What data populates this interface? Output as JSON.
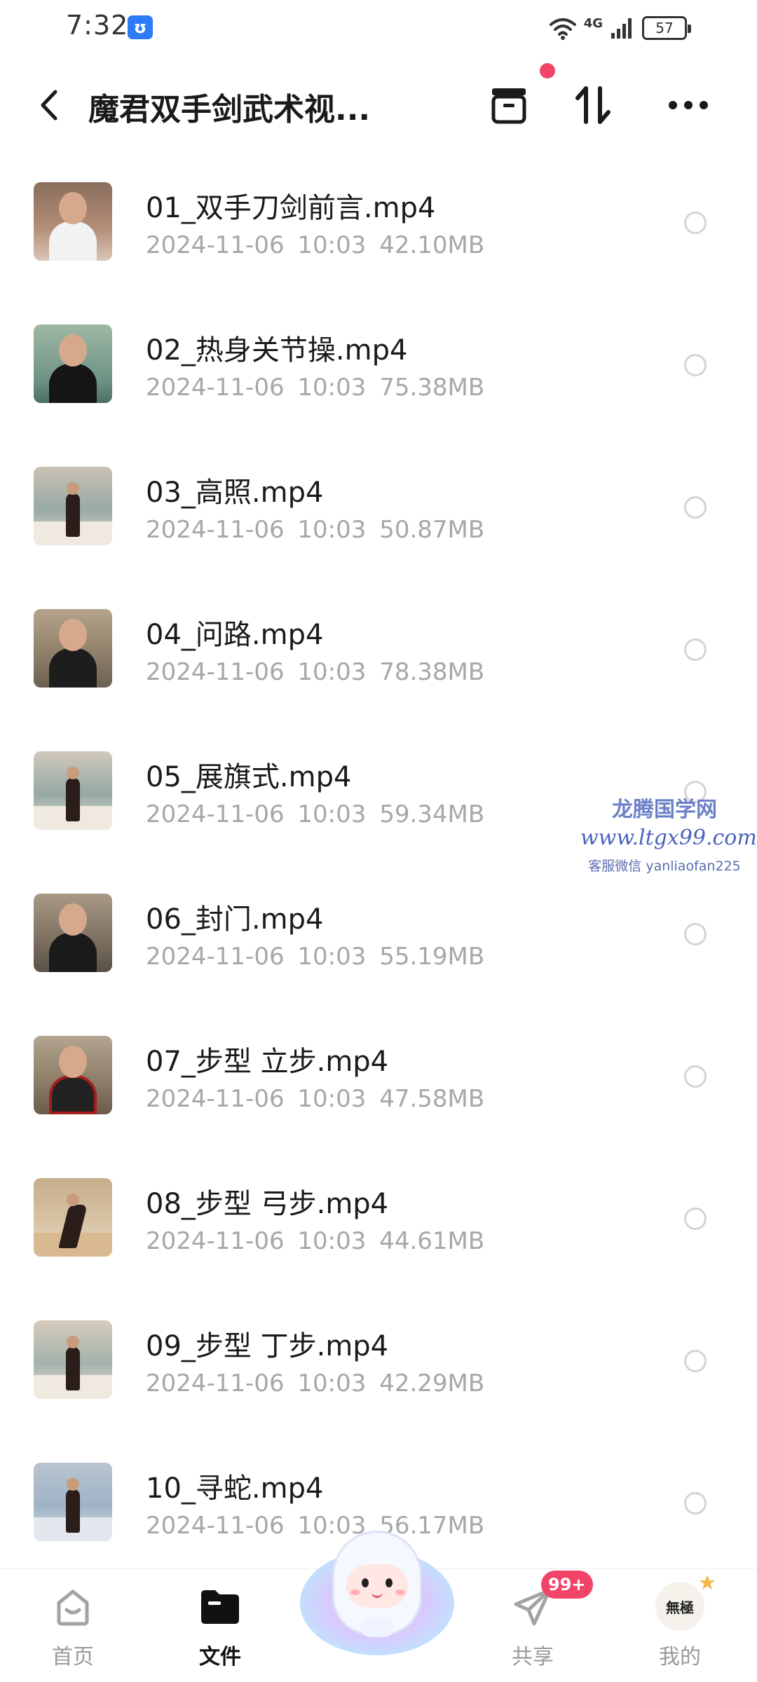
{
  "status_bar": {
    "time": "7:32",
    "app_icon_glyph": "ʊ",
    "network": "4G",
    "battery": "57"
  },
  "header": {
    "title": "魔君双手剑武术视..."
  },
  "files": [
    {
      "name": "01_双手刀剑前言.mp4",
      "meta": "2024-11-06  10:03  42.10MB"
    },
    {
      "name": "02_热身关节操.mp4",
      "meta": "2024-11-06  10:03  75.38MB"
    },
    {
      "name": "03_高照.mp4",
      "meta": "2024-11-06  10:03  50.87MB"
    },
    {
      "name": "04_问路.mp4",
      "meta": "2024-11-06  10:03  78.38MB"
    },
    {
      "name": "05_展旗式.mp4",
      "meta": "2024-11-06  10:03  59.34MB"
    },
    {
      "name": "06_封门.mp4",
      "meta": "2024-11-06  10:03  55.19MB"
    },
    {
      "name": "07_步型 立步.mp4",
      "meta": "2024-11-06  10:03  47.58MB"
    },
    {
      "name": "08_步型 弓步.mp4",
      "meta": "2024-11-06  10:03  44.61MB"
    },
    {
      "name": "09_步型 丁步.mp4",
      "meta": "2024-11-06  10:03  42.29MB"
    },
    {
      "name": "10_寻蛇.mp4",
      "meta": "2024-11-06  10:03  56.17MB"
    }
  ],
  "watermark": {
    "line1": "龙腾国学网",
    "line2": "www.ltgx99.com",
    "line3": "客服微信 yanliaofan225"
  },
  "bottom_nav": {
    "home": "首页",
    "files": "文件",
    "share": "共享",
    "share_badge": "99+",
    "mine": "我的",
    "avatar_text": "無極"
  },
  "colors": {
    "accent": "#f24468",
    "text": "#1a1a1a",
    "meta": "#a7a7a7"
  }
}
